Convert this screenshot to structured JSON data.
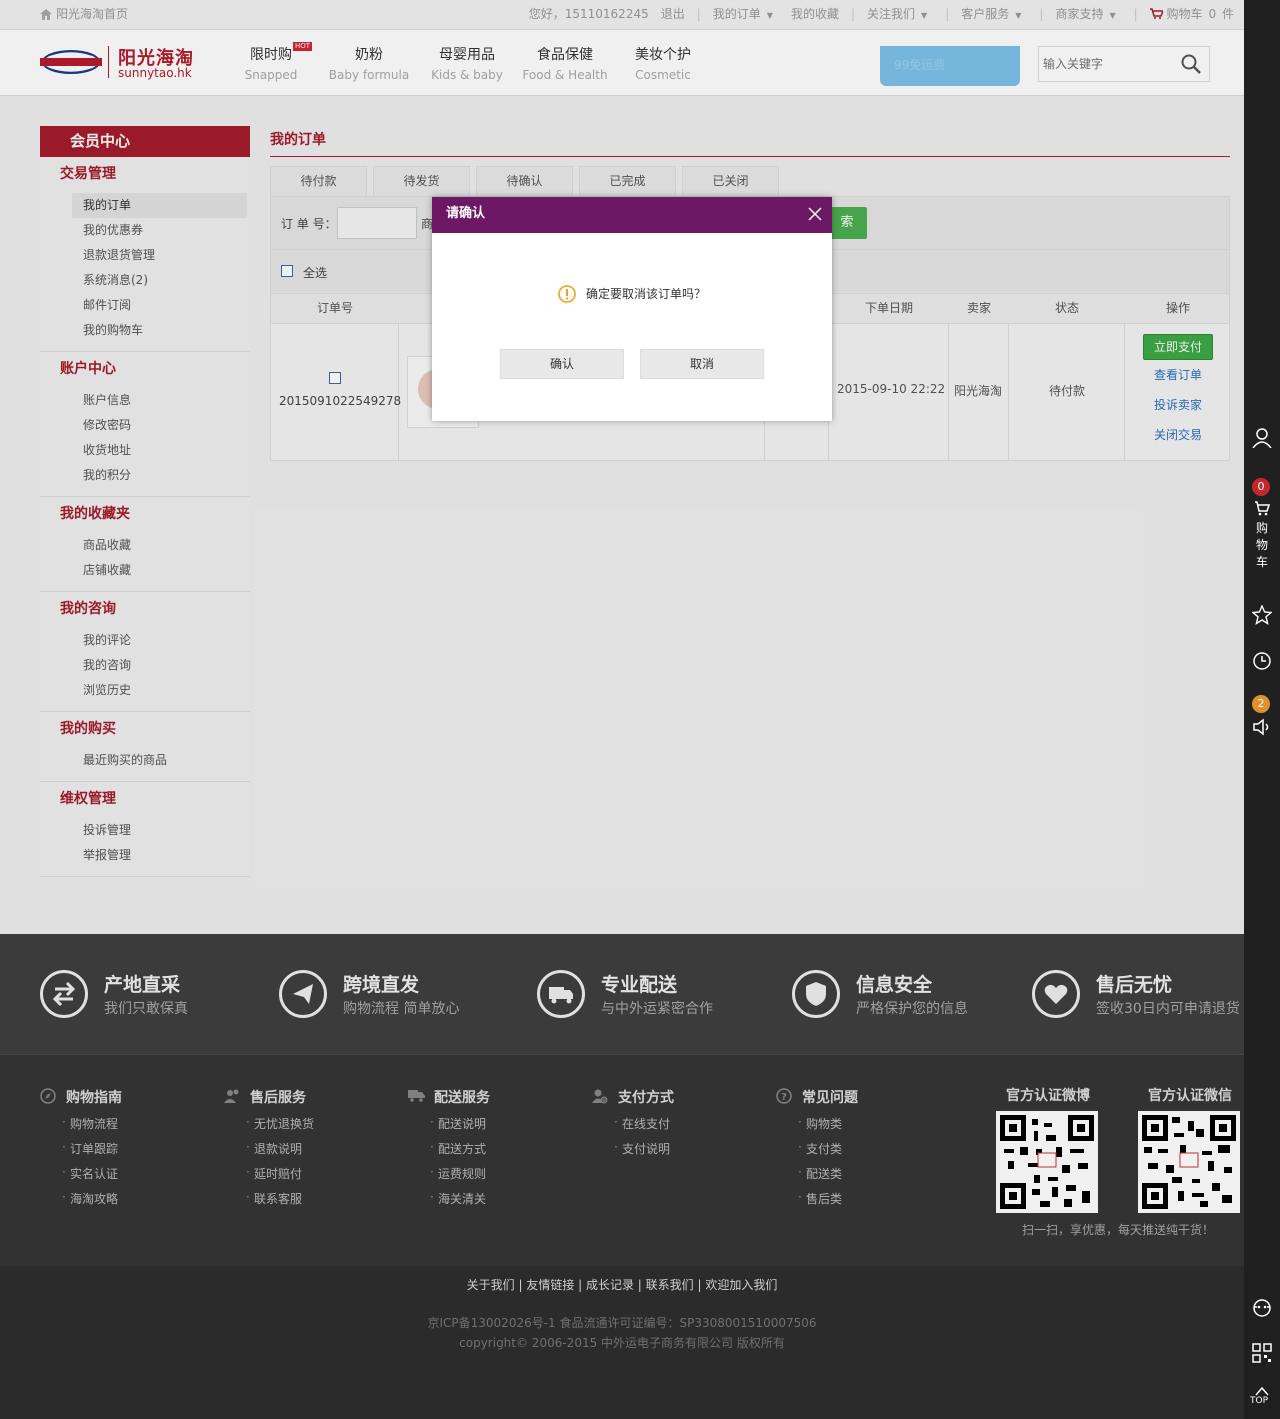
{
  "topbar": {
    "home": "阳光海淘首页",
    "greeting": "您好，15110162245",
    "logout": "退出",
    "my_orders": "我的订单",
    "my_favorites": "我的收藏",
    "follow_us": "关注我们",
    "customer_service": "客户服务",
    "merchant_support": "商家支持",
    "cart_label": "购物车",
    "cart_count": "0",
    "cart_unit": "件"
  },
  "header": {
    "logo_cn": "阳光海淘",
    "logo_en": "sunnytao.hk",
    "nav": [
      {
        "cn": "限时购",
        "en": "Snapped",
        "badge": "HOT"
      },
      {
        "cn": "奶粉",
        "en": "Baby formula"
      },
      {
        "cn": "母婴用品",
        "en": "Kids & baby"
      },
      {
        "cn": "食品保健",
        "en": "Food & Health"
      },
      {
        "cn": "美妆个护",
        "en": "Cosmetic"
      }
    ],
    "banner_text": "99免运费",
    "search_placeholder": "输入关键字"
  },
  "sidebar": {
    "title": "会员中心",
    "groups": [
      {
        "title": "交易管理",
        "items": [
          "我的订单",
          "我的优惠券",
          "退款退货管理",
          "系统消息(2)",
          "邮件订阅",
          "我的购物车"
        ]
      },
      {
        "title": "账户中心",
        "items": [
          "账户信息",
          "修改密码",
          "收货地址",
          "我的积分"
        ]
      },
      {
        "title": "我的收藏夹",
        "items": [
          "商品收藏",
          "店铺收藏"
        ]
      },
      {
        "title": "我的咨询",
        "items": [
          "我的评论",
          "我的咨询",
          "浏览历史"
        ]
      },
      {
        "title": "我的购买",
        "items": [
          "最近购买的商品"
        ]
      },
      {
        "title": "维权管理",
        "items": [
          "投诉管理",
          "举报管理"
        ]
      }
    ]
  },
  "main": {
    "title": "我的订单",
    "tabs": [
      "待付款",
      "待发货",
      "待确认",
      "已完成",
      "已关闭"
    ],
    "filter_order_label": "订 单 号：",
    "filter_product_label": "商",
    "search_btn": "索",
    "select_all": "全选",
    "columns": {
      "order_no": "订单号",
      "date": "下单日期",
      "seller": "卖家",
      "status": "状态",
      "ops": "操作"
    },
    "row": {
      "order_no": "2015091022549278",
      "date": "2015-09-10 22:22",
      "seller": "阳光海淘",
      "status": "待付款",
      "pay": "立即支付",
      "view": "查看订单",
      "complain": "投诉卖家",
      "close": "关闭交易"
    }
  },
  "modal": {
    "title": "请确认",
    "message": "确定要取消该订单吗？",
    "confirm": "确认",
    "cancel": "取消"
  },
  "features": [
    {
      "title": "产地直采",
      "sub": "我们只敢保真",
      "icon": "exchange-icon"
    },
    {
      "title": "跨境直发",
      "sub": "购物流程 简单放心",
      "icon": "plane-icon"
    },
    {
      "title": "专业配送",
      "sub": "与中外运紧密合作",
      "icon": "truck-icon"
    },
    {
      "title": "信息安全",
      "sub": "严格保护您的信息",
      "icon": "shield-icon"
    },
    {
      "title": "售后无忧",
      "sub": "签收30日内可申请退货",
      "icon": "heart-icon"
    }
  ],
  "footer_links": [
    {
      "title": "购物指南",
      "items": [
        "购物流程",
        "订单跟踪",
        "实名认证",
        "海淘攻略"
      ]
    },
    {
      "title": "售后服务",
      "items": [
        "无忧退换货",
        "退款说明",
        "延时赔付",
        "联系客服"
      ]
    },
    {
      "title": "配送服务",
      "items": [
        "配送说明",
        "配送方式",
        "运费规则",
        "海关清关"
      ]
    },
    {
      "title": "支付方式",
      "items": [
        "在线支付",
        "支付说明"
      ]
    },
    {
      "title": "常见问题",
      "items": [
        "购物类",
        "支付类",
        "配送类",
        "售后类"
      ]
    }
  ],
  "qr": {
    "weibo": "官方认证微博",
    "weixin": "官方认证微信",
    "caption": "扫一扫，享优惠，每天推送纯干货！"
  },
  "bottom": {
    "links": "关于我们 | 友情链接 | 成长记录 | 联系我们 | 欢迎加入我们",
    "icp": "京ICP备13002026号-1   食品流通许可证编号：SP3308001510007506",
    "copyright": "copyright© 2006-2015 中外运电子商务有限公司  版权所有"
  },
  "rightbar": {
    "cart_badge": "0",
    "cart_text": "购物车",
    "msg_badge": "2",
    "top_text": "TOP"
  },
  "colors": {
    "brand_red": "#a51c2c",
    "modal_header": "#6d1864",
    "pay_green": "#3ea847",
    "link_blue": "#2b6fc6"
  }
}
